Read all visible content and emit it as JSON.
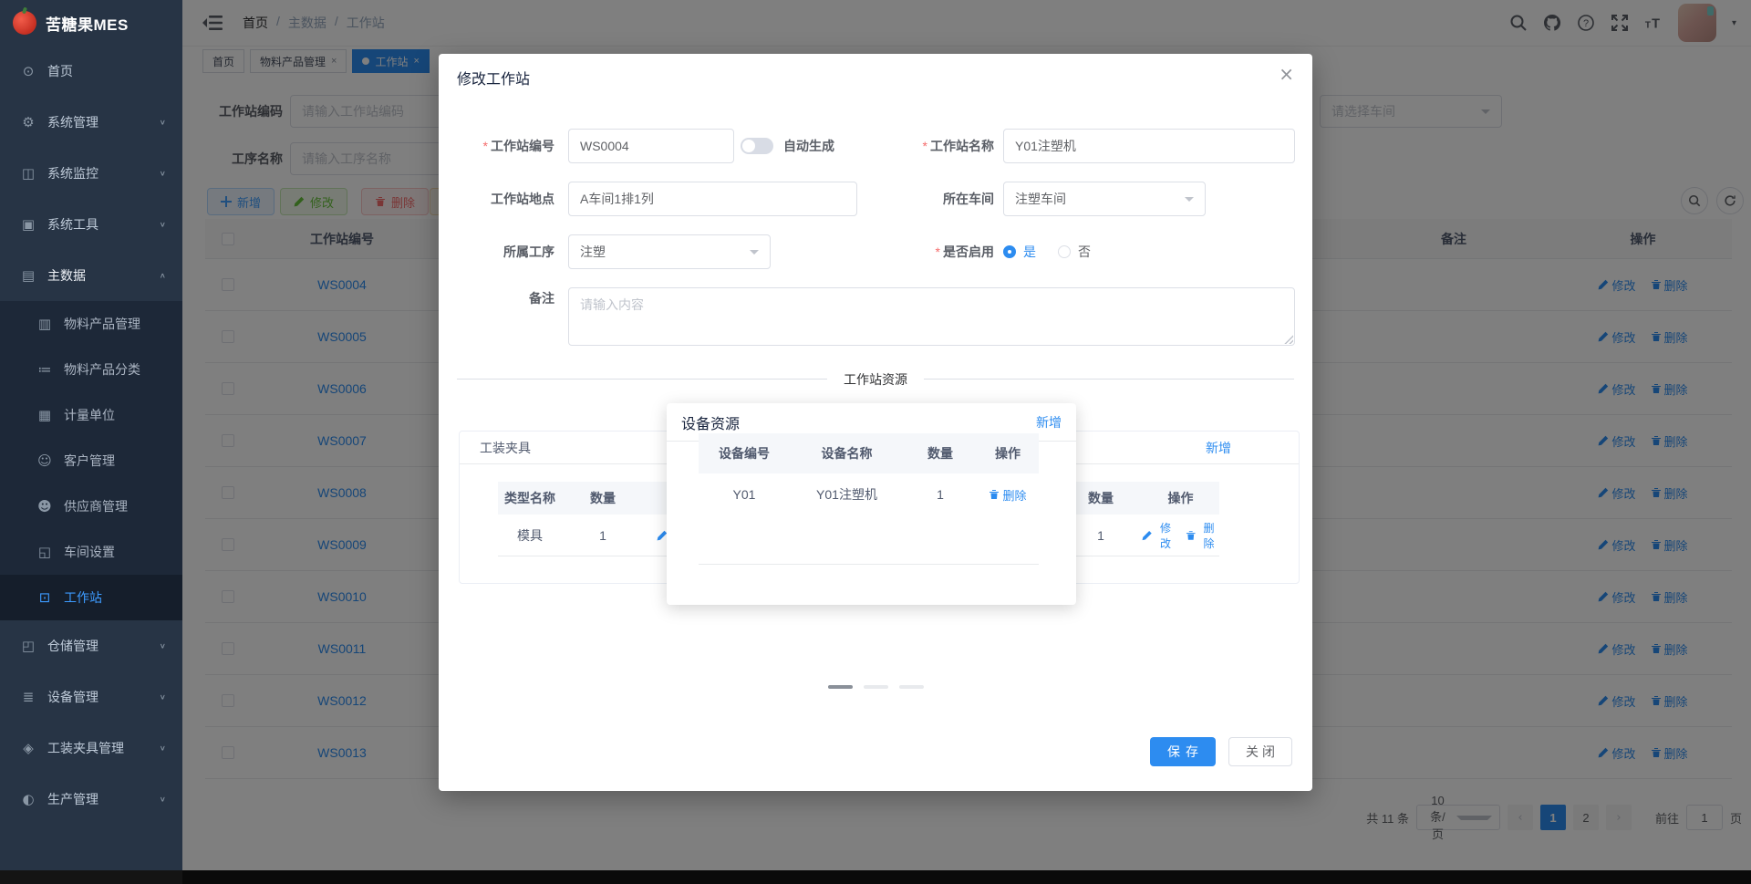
{
  "colors": {
    "primary": "#2d8cf0",
    "success": "#67c23a",
    "danger": "#f56c6c",
    "warning": "#e6a23c",
    "sidebar_bg": "#273445",
    "active_menu": "#3d9bff"
  },
  "brand": {
    "name": "苦糖果MES"
  },
  "sidebar": {
    "items": [
      {
        "name": "home",
        "label": "首页",
        "glyph": "⊙",
        "level": 1,
        "chevron": ""
      },
      {
        "name": "system-mgmt",
        "label": "系统管理",
        "glyph": "⚙",
        "level": 1,
        "chevron": "∨"
      },
      {
        "name": "system-monitor",
        "label": "系统监控",
        "glyph": "◫",
        "level": 1,
        "chevron": "∨"
      },
      {
        "name": "system-tools",
        "label": "系统工具",
        "glyph": "▣",
        "level": 1,
        "chevron": "∨"
      },
      {
        "name": "master-data",
        "label": "主数据",
        "glyph": "▤",
        "level": 1,
        "chevron": "∧",
        "expanded": true
      },
      {
        "name": "material-product-mgmt",
        "label": "物料产品管理",
        "glyph": "▥",
        "level": 2
      },
      {
        "name": "material-product-category",
        "label": "物料产品分类",
        "glyph": "≔",
        "level": 2
      },
      {
        "name": "measure-unit",
        "label": "计量单位",
        "glyph": "▦",
        "level": 2
      },
      {
        "name": "customer-mgmt",
        "label": "客户管理",
        "glyph": "☺",
        "level": 2
      },
      {
        "name": "supplier-mgmt",
        "label": "供应商管理",
        "glyph": "☻",
        "level": 2
      },
      {
        "name": "workshop-settings",
        "label": "车间设置",
        "glyph": "◱",
        "level": 2
      },
      {
        "name": "workstation",
        "label": "工作站",
        "glyph": "⊡",
        "level": 2,
        "active": true
      },
      {
        "name": "warehouse-mgmt",
        "label": "仓储管理",
        "glyph": "◰",
        "level": 1,
        "chevron": "∨"
      },
      {
        "name": "equipment-mgmt",
        "label": "设备管理",
        "glyph": "≣",
        "level": 1,
        "chevron": "∨"
      },
      {
        "name": "fixture-mgmt",
        "label": "工装夹具管理",
        "glyph": "◈",
        "level": 1,
        "chevron": "∨"
      },
      {
        "name": "production-mgmt",
        "label": "生产管理",
        "glyph": "◐",
        "level": 1,
        "chevron": "∨"
      }
    ]
  },
  "topbar": {
    "breadcrumb": {
      "items": [
        "首页",
        "主数据",
        "工作站"
      ],
      "separator": "/"
    },
    "icons": [
      "search",
      "github",
      "help",
      "fullscreen",
      "font-size"
    ],
    "caret": "▾"
  },
  "tags": [
    {
      "label": "首页",
      "closable": false,
      "active": false
    },
    {
      "label": "物料产品管理",
      "closable": true,
      "active": false
    },
    {
      "label": "工作站",
      "closable": true,
      "active": true
    }
  ],
  "tag_close_glyph": "×",
  "filters": {
    "rows": [
      {
        "label": "工作站编码",
        "placeholder": "请输入工作站编码"
      },
      {
        "label": "工序名称",
        "placeholder": "请输入工序名称"
      }
    ],
    "workshop_placeholder": "请选择车间"
  },
  "toolbar": {
    "buttons": [
      {
        "label": "新增",
        "type": "primary",
        "icon": "plus"
      },
      {
        "label": "修改",
        "type": "success",
        "icon": "edit"
      },
      {
        "label": "删除",
        "type": "danger",
        "icon": "trash"
      },
      {
        "label": "",
        "type": "warning",
        "icon": ""
      }
    ]
  },
  "table": {
    "headers": {
      "code": "工作站编号",
      "remark": "备注",
      "op": "操作"
    },
    "actions": {
      "edit": "修改",
      "delete": "删除"
    },
    "rows": [
      {
        "code": "WS0004",
        "remark": ""
      },
      {
        "code": "WS0005",
        "remark": ""
      },
      {
        "code": "WS0006",
        "remark": ""
      },
      {
        "code": "WS0007",
        "remark": ""
      },
      {
        "code": "WS0008",
        "remark": ""
      },
      {
        "code": "WS0009",
        "remark": ""
      },
      {
        "code": "WS0010",
        "remark": ""
      },
      {
        "code": "WS0011",
        "remark": ""
      },
      {
        "code": "WS0012",
        "remark": ""
      },
      {
        "code": "WS0013",
        "remark": ""
      }
    ]
  },
  "pagination": {
    "total": "共 11 条",
    "page_size": "10条/页",
    "prev": "‹",
    "next": "›",
    "pages": [
      "1",
      "2"
    ],
    "current": "1",
    "goto_label": "前往",
    "goto_value": "1",
    "unit": "页"
  },
  "dialog": {
    "title": "修改工作站",
    "close_glyph": "×",
    "required_mark": "*",
    "code": {
      "label": "工作站编号",
      "value": "WS0004"
    },
    "auto_generate_label": "自动生成",
    "name": {
      "label": "工作站名称",
      "value": "Y01注塑机"
    },
    "location": {
      "label": "工作站地点",
      "value": "A车间1排1列"
    },
    "workshop": {
      "label": "所在车间",
      "value": "注塑车间"
    },
    "process": {
      "label": "所属工序",
      "value": "注塑"
    },
    "enabled": {
      "label": "是否启用",
      "yes": "是",
      "no": "否",
      "selected": "是"
    },
    "remark": {
      "label": "备注",
      "placeholder": "请输入内容"
    },
    "section_title": "工作站资源",
    "fixture": {
      "title": "工装夹具",
      "add": "新增",
      "headers": {
        "type": "类型名称",
        "qty": "数量",
        "op": "操作"
      },
      "row": {
        "type": "模具",
        "qty": "1"
      },
      "edit": "修改",
      "delete": "删除"
    },
    "right_table": {
      "headers": {
        "qty": "数量",
        "op": "操作"
      },
      "row": {
        "qty": "1"
      },
      "edit": "修改",
      "delete": "删除"
    },
    "equipment": {
      "title": "设备资源",
      "add": "新增",
      "headers": {
        "code": "设备编号",
        "name": "设备名称",
        "qty": "数量",
        "op": "操作"
      },
      "row": {
        "code": "Y01",
        "name": "Y01注塑机",
        "qty": "1"
      },
      "delete": "删除"
    },
    "save": "保存",
    "close": "关闭"
  }
}
